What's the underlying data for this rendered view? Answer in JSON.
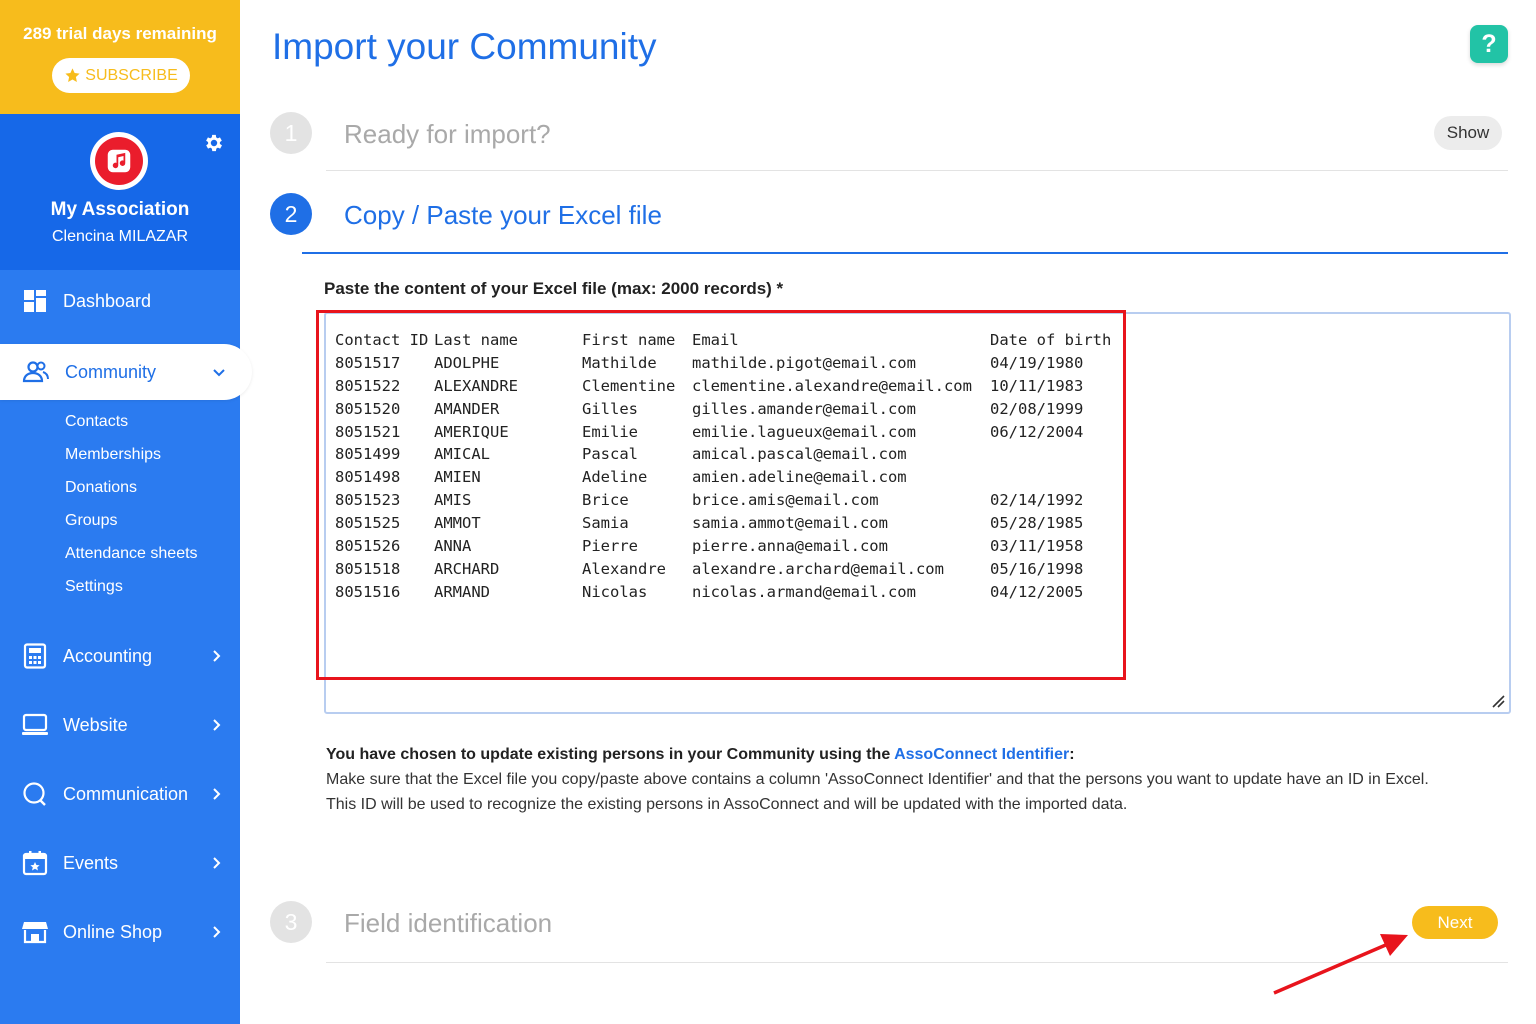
{
  "trial": {
    "text": "289 trial days remaining",
    "subscribe_label": "SUBSCRIBE"
  },
  "association": {
    "name": "My Association",
    "user": "Clencina MILAZAR"
  },
  "nav": {
    "dashboard": "Dashboard",
    "community": "Community",
    "community_sub": [
      "Contacts",
      "Memberships",
      "Donations",
      "Groups",
      "Attendance sheets",
      "Settings"
    ],
    "accounting": "Accounting",
    "website": "Website",
    "communication": "Communication",
    "events": "Events",
    "online_shop": "Online Shop"
  },
  "page": {
    "title": "Import your Community",
    "help_label": "?"
  },
  "steps": [
    {
      "number": "1",
      "title": "Ready for import?",
      "show_label": "Show"
    },
    {
      "number": "2",
      "title": "Copy / Paste your Excel file"
    },
    {
      "number": "3",
      "title": "Field identification"
    }
  ],
  "paste": {
    "label": "Paste the content of your Excel file (max: 2000 records) *",
    "headers": [
      "Contact ID",
      "Last name",
      "First name",
      "Email",
      "Date of birth"
    ],
    "rows": [
      [
        "8051517",
        "ADOLPHE",
        "Mathilde",
        "mathilde.pigot@email.com",
        "04/19/1980"
      ],
      [
        "8051522",
        "ALEXANDRE",
        "Clementine",
        "clementine.alexandre@email.com",
        "10/11/1983"
      ],
      [
        "8051520",
        "AMANDER",
        "Gilles",
        "gilles.amander@email.com",
        "02/08/1999"
      ],
      [
        "8051521",
        "AMERIQUE",
        "Emilie",
        "emilie.lagueux@email.com",
        "06/12/2004"
      ],
      [
        "8051499",
        "AMICAL",
        "Pascal",
        "amical.pascal@email.com",
        ""
      ],
      [
        "8051498",
        "AMIEN",
        "Adeline",
        "amien.adeline@email.com",
        ""
      ],
      [
        "8051523",
        "AMIS",
        "Brice",
        "brice.amis@email.com",
        "02/14/1992"
      ],
      [
        "8051525",
        "AMMOT",
        "Samia",
        "samia.ammot@email.com",
        "05/28/1985"
      ],
      [
        "8051526",
        "ANNA",
        "Pierre",
        "pierre.anna@email.com",
        "03/11/1958"
      ],
      [
        "8051518",
        "ARCHARD",
        "Alexandre",
        "alexandre.archard@email.com",
        "05/16/1998"
      ],
      [
        "8051516",
        "ARMAND",
        "Nicolas",
        "nicolas.armand@email.com",
        "04/12/2005"
      ]
    ]
  },
  "info": {
    "lead": "You have chosen to update existing persons in your Community using the ",
    "link": "AssoConnect Identifier",
    "colon": ":",
    "line1": "Make sure that the Excel file you copy/paste above contains a column 'AssoConnect Identifier' and that the persons you want to update have an ID in Excel.",
    "line2": "This ID will be used to recognize the existing persons in AssoConnect and will be updated with the imported data."
  },
  "next_label": "Next",
  "colors": {
    "brand_blue": "#1f6fe6",
    "sidebar_blue": "#2b7bf0",
    "yellow": "#f7bc1c",
    "help_teal": "#22c3a6",
    "highlight_red": "#e8141c"
  },
  "icons": [
    "star-icon",
    "music-note-icon",
    "gear-icon",
    "dashboard-icon",
    "community-icon",
    "accounting-icon",
    "website-icon",
    "communication-icon",
    "events-icon",
    "online-shop-icon",
    "chevron-down-icon",
    "chevron-right-icon",
    "resize-handle-icon",
    "arrow-annotation"
  ]
}
